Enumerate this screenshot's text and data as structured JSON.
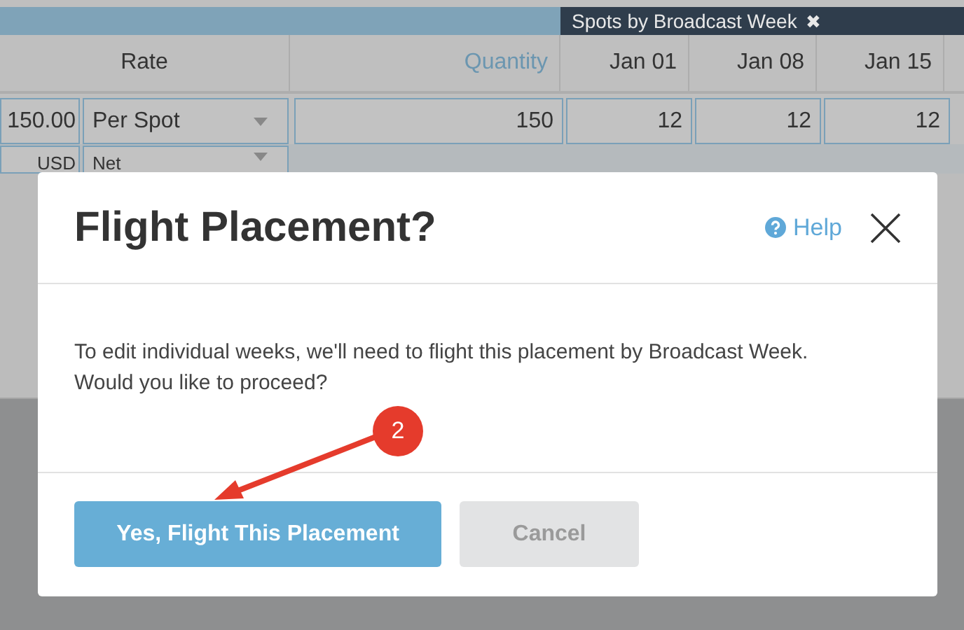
{
  "toolbar": {
    "tag": {
      "label": "Spots by Broadcast Week",
      "close": "✖"
    }
  },
  "table": {
    "columns": [
      {
        "label": "Rate",
        "highlighted": false
      },
      {
        "label": "Quantity",
        "highlighted": true
      },
      {
        "label": "Jan 01",
        "highlighted": false
      },
      {
        "label": "Jan 08",
        "highlighted": false
      },
      {
        "label": "Jan 15",
        "highlighted": false
      }
    ],
    "rows": [
      {
        "rate": "150.00",
        "rate_type": "Per Spot",
        "quantity": "150",
        "weeks": [
          "12",
          "12",
          "12"
        ]
      },
      {
        "rate": "USD",
        "rate_type": "Net"
      }
    ]
  },
  "dialog": {
    "title": "Flight Placement?",
    "help": "Help",
    "message": "To edit individual weeks, we'll need to flight this placement by Broadcast Week. Would you like to proceed?",
    "buttons": [
      {
        "label": "Yes, Flight This Placement",
        "kind": "primary"
      },
      {
        "label": "Cancel",
        "kind": "secondary"
      }
    ]
  },
  "annotation": {
    "number": "2"
  }
}
